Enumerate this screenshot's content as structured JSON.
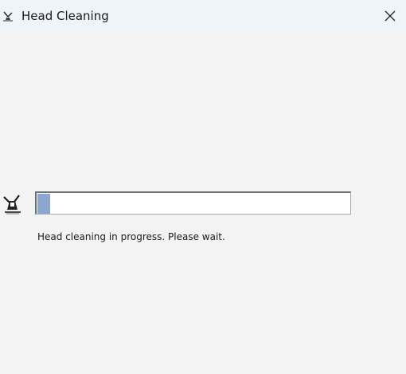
{
  "window": {
    "title": "Head Cleaning",
    "title_icon": "printer-icon",
    "close_icon": "close-icon"
  },
  "dialog": {
    "icon": "printer-head-icon",
    "progress": 0.04,
    "status_text": "Head cleaning in progress. Please wait."
  },
  "colors": {
    "titlebar": "#eff4f9",
    "background": "#f3f3f3",
    "progress_fill": "#8aa7cf"
  }
}
